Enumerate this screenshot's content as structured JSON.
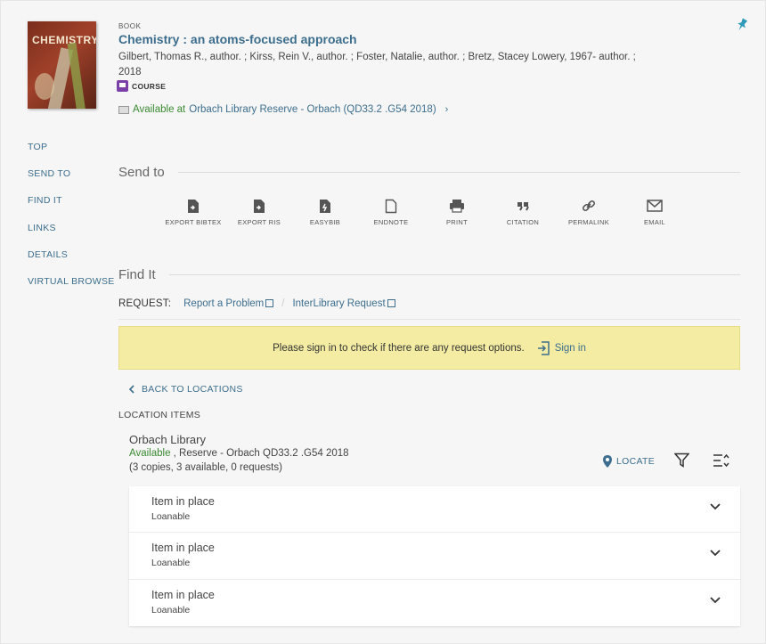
{
  "record": {
    "type": "BOOK",
    "title": "Chemistry : an atoms-focused approach",
    "authors": "Gilbert, Thomas R., author. ; Kirss, Rein V., author. ; Foster, Natalie, author. ; Bretz, Stacey Lowery, 1967- author. ;",
    "year": "2018",
    "course_label": "COURSE",
    "availability_prefix": "Available at",
    "availability_location": "Orbach Library  Reserve - Orbach (QD33.2 .G54 2018)",
    "cover_text": "CHEMISTRY"
  },
  "sidenav": {
    "items": [
      "TOP",
      "SEND TO",
      "FIND IT",
      "LINKS",
      "DETAILS",
      "VIRTUAL BROWSE"
    ]
  },
  "send_to": {
    "title": "Send to",
    "actions": [
      {
        "label": "EXPORT BIBTEX",
        "icon": "file-export-icon"
      },
      {
        "label": "EXPORT RIS",
        "icon": "file-export-icon"
      },
      {
        "label": "EASYBIB",
        "icon": "file-bolt-icon"
      },
      {
        "label": "ENDNOTE",
        "icon": "document-icon"
      },
      {
        "label": "PRINT",
        "icon": "printer-icon"
      },
      {
        "label": "CITATION",
        "icon": "quote-icon"
      },
      {
        "label": "PERMALINK",
        "icon": "link-icon"
      },
      {
        "label": "EMAIL",
        "icon": "envelope-icon"
      }
    ]
  },
  "find_it": {
    "title": "Find It",
    "request_label": "REQUEST:",
    "report_link": "Report a Problem",
    "ill_link": "InterLibrary Request",
    "signin_message": "Please sign in to check if there are any request options.",
    "signin_label": "Sign in",
    "back_label": "BACK TO LOCATIONS",
    "location_items_label": "LOCATION ITEMS",
    "library_name": "Orbach Library",
    "library_status": "Available",
    "library_location": " , Reserve - Orbach QD33.2 .G54 2018",
    "library_copies": "(3 copies, 3 available, 0 requests)",
    "locate_label": "LOCATE",
    "items": [
      {
        "status": "Item in place",
        "policy": "Loanable"
      },
      {
        "status": "Item in place",
        "policy": "Loanable"
      },
      {
        "status": "Item in place",
        "policy": "Loanable"
      }
    ]
  },
  "colors": {
    "link": "#3d6e8e",
    "available": "#3a8a32",
    "signin_bar": "#f4eca2",
    "pin": "#2e9ab8",
    "course": "#7b3fa8"
  }
}
